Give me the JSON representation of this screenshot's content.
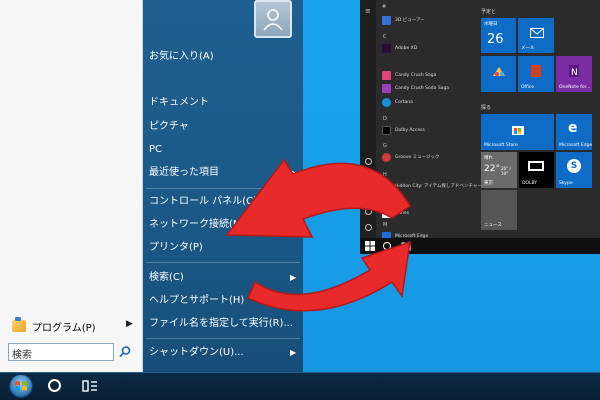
{
  "classic_menu": {
    "programs_label": "プログラム(P)",
    "search_value": "検索",
    "right_items": [
      {
        "key": "favorites",
        "label": "お気に入り(A)"
      },
      {
        "key": "documents",
        "label": "ドキュメント"
      },
      {
        "key": "pictures",
        "label": "ピクチャ"
      },
      {
        "key": "pc",
        "label": "PC"
      },
      {
        "key": "recent",
        "label": "最近使った項目"
      },
      {
        "key": "control_panel",
        "label": "コントロール パネル(C)"
      },
      {
        "key": "network",
        "label": "ネットワーク接続(N)"
      },
      {
        "key": "printers",
        "label": "プリンタ(P)"
      },
      {
        "key": "search",
        "label": "検索(C)"
      },
      {
        "key": "help",
        "label": "ヘルプとサポート(H)"
      },
      {
        "key": "run",
        "label": "ファイル名を指定して実行(R)..."
      },
      {
        "key": "shutdown",
        "label": "シャットダウン(U)..."
      }
    ]
  },
  "w10_menu": {
    "list_header": "#",
    "apps": [
      {
        "label": "3D ビューアー",
        "color": "#3a6fd8"
      },
      {
        "label": "Adobe XD",
        "color": "#2b0a3d"
      },
      {
        "label": "Candy Crush Saga",
        "color": "#e0457b"
      },
      {
        "label": "Candy Crush Soda Saga",
        "color": "#9b3fbf"
      },
      {
        "label": "Cortana",
        "color": "#1a8fd8"
      },
      {
        "label": "Dolby Access",
        "color": "#000000"
      },
      {
        "label": "Groove ミュージック",
        "color": "#d13a3a"
      },
      {
        "label": "Hidden City: アイテム探しアドベンチャー",
        "color": "#4a3a2a"
      },
      {
        "label": "iTunes",
        "color": "#f2f2f2"
      },
      {
        "label": "Microsoft Edge",
        "color": "#1a6fd8"
      }
    ],
    "letters": {
      "c": "C",
      "d": "D",
      "g": "G",
      "h": "H",
      "i": "I",
      "m": "M"
    },
    "group_labels": {
      "schedule": "予定と",
      "browse": "探る"
    },
    "tiles": {
      "calendar_day_name": "水曜日",
      "calendar_day_num": "26",
      "mail": "メール",
      "office": "Office",
      "onenote": "OneNote for...",
      "store": "Microsoft Store",
      "edge": "Microsoft Edge",
      "weather_cond": "晴れ",
      "weather_temp": "22°",
      "weather_hi_lo": "26° / 19°",
      "weather_city": "東京",
      "dolby": "DOLBY",
      "skype": "Skype",
      "news": "ニュース"
    }
  },
  "colors": {
    "arrow": "#e82a2a",
    "tile_blue": "#0f6cc6",
    "classic_blue": "#1d5b89"
  }
}
